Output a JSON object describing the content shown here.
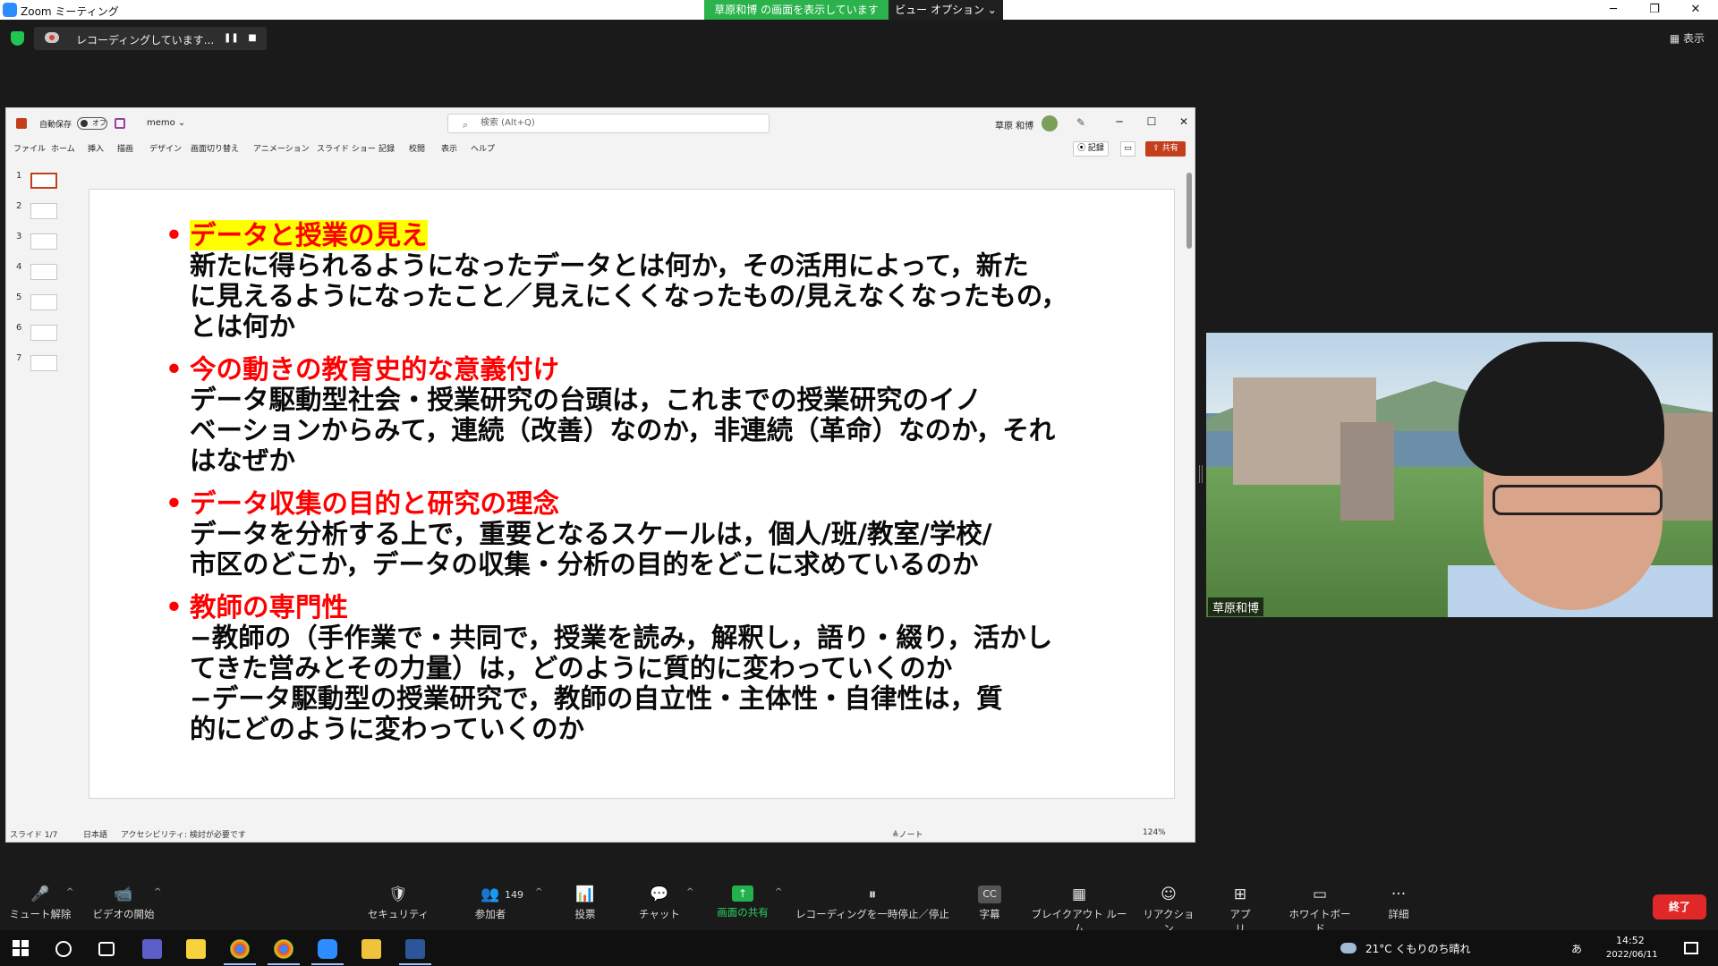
{
  "window": {
    "title": "Zoom ミーティング",
    "share_banner": "草原和博 の画面を表示しています",
    "view_options": "ビュー オプション ⌄",
    "minimize": "─",
    "restore": "❐",
    "close": "✕"
  },
  "recording": {
    "status": "レコーディングしています...",
    "pause": "❚❚",
    "stop": "■",
    "view_label": "▦ 表示"
  },
  "ppt": {
    "autosave": "自動保存",
    "toggle": "オフ",
    "doc_name": "memo ⌄",
    "search_placeholder": "検索 (Alt+Q)",
    "search_icon": "⌕",
    "user": "草原 和博",
    "pen": "✎",
    "min": "─",
    "max": "☐",
    "close": "✕",
    "menu": [
      "ファイル",
      "ホーム",
      "挿入",
      "描画",
      "デザイン",
      "画面切り替え",
      "アニメーション",
      "スライド ショー",
      "記録",
      "校閲",
      "表示",
      "ヘルプ"
    ],
    "record_btn": "⦿ 記録",
    "comment_btn": "▭",
    "share_btn": "⇪ 共有",
    "thumbs": [
      "1",
      "2",
      "3",
      "4",
      "5",
      "6",
      "7"
    ],
    "status": {
      "slide": "スライド 1/7",
      "lang": "日本語",
      "access": "アクセシビリティ: 検討が必要です",
      "notes": "≜ノート",
      "zoom": "124%"
    }
  },
  "slide": {
    "bullet": "•",
    "items": [
      {
        "head": "データと授業の見え",
        "lines": [
          "新たに得られるようになったデータとは何か，その活用によって，新た",
          "に見えるようになったこと／見えにくくなったもの/見えなくなったもの，",
          "とは何か"
        ]
      },
      {
        "head": "今の動きの教育史的な意義付け",
        "lines": [
          "データ駆動型社会・授業研究の台頭は，これまでの授業研究のイノ",
          "ベーションからみて，連続（改善）なのか，非連続（革命）なのか，それ",
          "はなぜか"
        ]
      },
      {
        "head": "データ収集の目的と研究の理念",
        "lines": [
          "データを分析する上で，重要となるスケールは，個人/班/教室/学校/",
          "市区のどこか，データの収集・分析の目的をどこに求めているのか"
        ]
      },
      {
        "head": "教師の専門性",
        "lines": [
          "−教師の（手作業で・共同で，授業を読み，解釈し，語り・綴り，活かし",
          "てきた営みとその力量）は，どのように質的に変わっていくのか",
          "−データ駆動型の授業研究で，教師の自立性・主体性・自律性は，質",
          "的にどのように変わっていくのか"
        ]
      }
    ]
  },
  "camera": {
    "name": "草原和博"
  },
  "toolbar": {
    "mute": "ミュート解除",
    "video": "ビデオの開始",
    "security": "セキュリティ",
    "participants": "参加者",
    "participants_count": "149",
    "poll": "投票",
    "chat": "チャット",
    "share": "画面の共有",
    "rec_pause": "レコーディングを一時停止／停止",
    "captions": "字幕",
    "breakout": "ブレイクアウト ルーム",
    "reactions": "リアクション",
    "apps": "アプリ",
    "whiteboard": "ホワイトボード",
    "more": "詳細",
    "end": "終了",
    "icons": {
      "mic": "🎤",
      "video": "📹",
      "shield": "🛡",
      "people": "👥",
      "poll": "📊",
      "chat": "💬",
      "share": "↑",
      "pause": "⏸",
      "cc": "CC",
      "grid": "▦",
      "react": "☺",
      "apps": "⊞",
      "board": "▭",
      "dots": "···",
      "caret": "^"
    }
  },
  "taskbar": {
    "weather": "21°C くもりのち晴れ",
    "time": "14:52",
    "date": "2022/06/11",
    "ime": "あ"
  }
}
